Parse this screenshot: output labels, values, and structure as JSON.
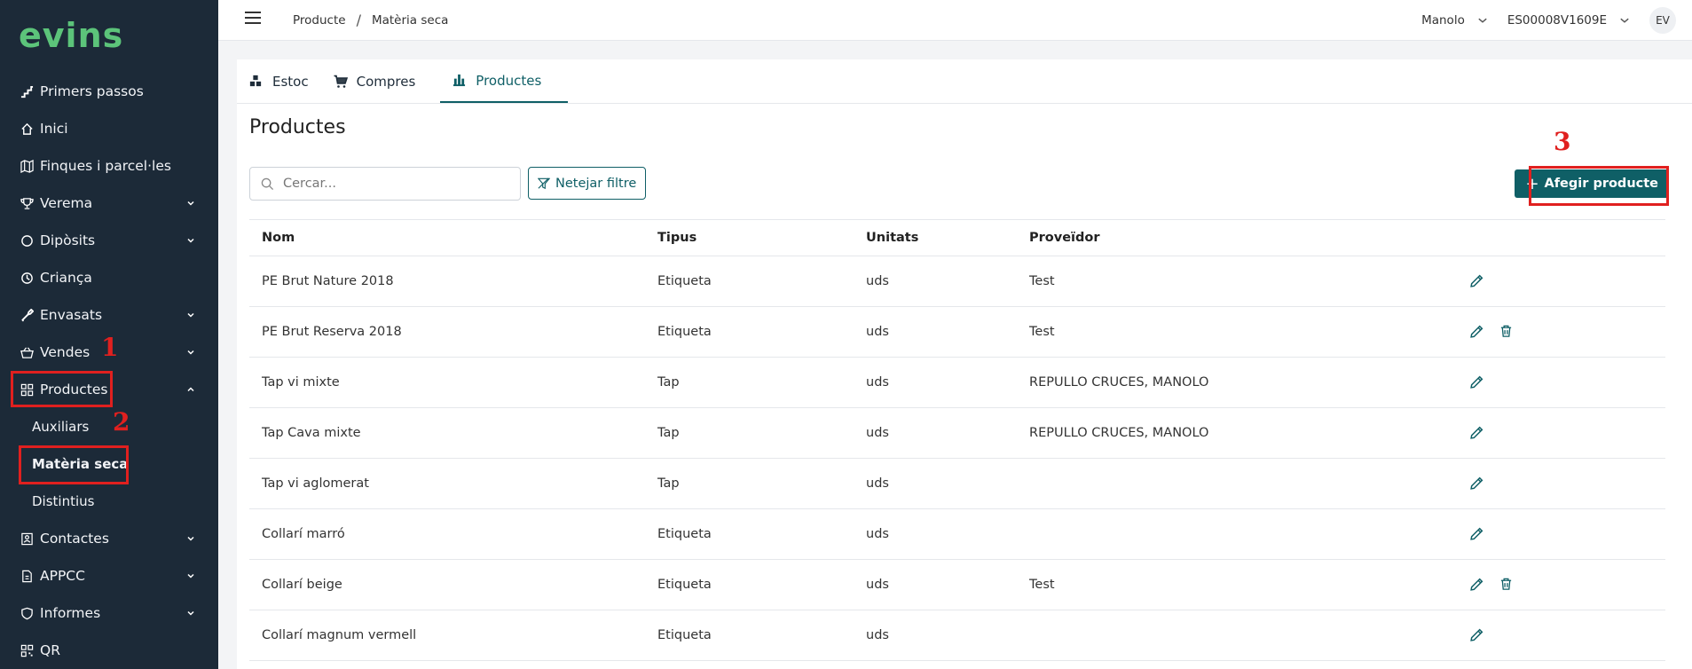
{
  "sidebar": {
    "logo": "evins",
    "items": [
      {
        "label": "Primers passos",
        "icon": "stairs-icon",
        "chev": false
      },
      {
        "label": "Inici",
        "icon": "home-icon",
        "chev": false
      },
      {
        "label": "Finques i parcel·les",
        "icon": "map-icon",
        "chev": false
      },
      {
        "label": "Verema",
        "icon": "trophy-icon",
        "chev": true
      },
      {
        "label": "Dipòsits",
        "icon": "circle-icon",
        "chev": true
      },
      {
        "label": "Criança",
        "icon": "clock-icon",
        "chev": false
      },
      {
        "label": "Envasats",
        "icon": "bottle-icon",
        "chev": true
      },
      {
        "label": "Vendes",
        "icon": "basket-icon",
        "chev": true
      },
      {
        "label": "Productes",
        "icon": "grid-icon",
        "chev": "up"
      }
    ],
    "sub_items": [
      {
        "label": "Auxiliars"
      },
      {
        "label": "Matèria seca"
      },
      {
        "label": "Distintius"
      }
    ],
    "items_after": [
      {
        "label": "Contactes",
        "icon": "contact-icon",
        "chev": true
      },
      {
        "label": "APPCC",
        "icon": "document-icon",
        "chev": true
      },
      {
        "label": "Informes",
        "icon": "shield-icon",
        "chev": true
      },
      {
        "label": "QR",
        "icon": "qr-icon",
        "chev": false
      }
    ],
    "annotations": [
      "1",
      "2",
      "3"
    ]
  },
  "topbar": {
    "breadcrumb": [
      "Producte",
      "Matèria seca"
    ],
    "user": "Manolo",
    "account": "ES00008V1609E",
    "avatar": "EV"
  },
  "tabs": [
    {
      "label": "Estoc",
      "icon": "boxes-icon"
    },
    {
      "label": "Compres",
      "icon": "cart-icon"
    },
    {
      "label": "Productes",
      "icon": "products-icon"
    }
  ],
  "main": {
    "title": "Productes",
    "search_placeholder": "Cercar...",
    "clear_filter": "Netejar filtre",
    "add_product": "Afegir producte",
    "columns": [
      "Nom",
      "Tipus",
      "Unitats",
      "Proveïdor"
    ],
    "rows": [
      {
        "nom": "PE Brut Nature 2018",
        "tipus": "Etiqueta",
        "unitats": "uds",
        "proveidor": "Test",
        "delete": false
      },
      {
        "nom": "PE Brut Reserva 2018",
        "tipus": "Etiqueta",
        "unitats": "uds",
        "proveidor": "Test",
        "delete": true
      },
      {
        "nom": "Tap vi mixte",
        "tipus": "Tap",
        "unitats": "uds",
        "proveidor": "REPULLO CRUCES, MANOLO",
        "delete": false
      },
      {
        "nom": "Tap Cava mixte",
        "tipus": "Tap",
        "unitats": "uds",
        "proveidor": "REPULLO CRUCES, MANOLO",
        "delete": false
      },
      {
        "nom": "Tap vi aglomerat",
        "tipus": "Tap",
        "unitats": "uds",
        "proveidor": "",
        "delete": false
      },
      {
        "nom": "Collarí marró",
        "tipus": "Etiqueta",
        "unitats": "uds",
        "proveidor": "",
        "delete": false
      },
      {
        "nom": "Collarí beige",
        "tipus": "Etiqueta",
        "unitats": "uds",
        "proveidor": "Test",
        "delete": true
      },
      {
        "nom": "Collarí magnum vermell",
        "tipus": "Etiqueta",
        "unitats": "uds",
        "proveidor": "",
        "delete": false
      }
    ]
  },
  "colors": {
    "sidebar": "#1c2a38",
    "accent": "#0f5f66",
    "annotation": "#e0201f",
    "logo": "#5cc47a"
  }
}
